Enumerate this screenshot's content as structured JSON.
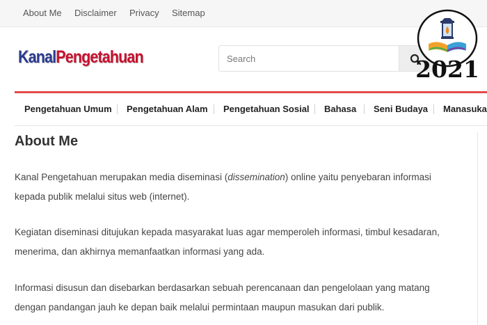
{
  "top_menu": {
    "items": [
      "About Me",
      "Disclaimer",
      "Privacy",
      "Sitemap"
    ]
  },
  "logo": {
    "part1": "Kanal",
    "part2": "Pengetahuan"
  },
  "search": {
    "placeholder": "Search",
    "icon": "search-icon"
  },
  "badge": {
    "year": "2021",
    "icon": "lantern-book-icon"
  },
  "nav": {
    "items": [
      "Pengetahuan Umum",
      "Pengetahuan Alam",
      "Pengetahuan Sosial",
      "Bahasa",
      "Seni Budaya",
      "Manasuka"
    ]
  },
  "colors": {
    "accent": "#e44a4a",
    "logo_blue": "#2b3a8f",
    "logo_red": "#c8102e"
  },
  "content": {
    "title": "About Me",
    "p1": {
      "before": "Kanal Pengetahuan merupakan media diseminasi (",
      "em": "dissemination",
      "after": ") online yaitu penyebaran informasi",
      "line2": "kepada publik melalui situs web (internet)."
    },
    "p2": {
      "line1": "Kegiatan diseminasi ditujukan kepada masyarakat luas agar memperoleh informasi, timbul kesadaran,",
      "line2": "menerima, dan akhirnya memanfaatkan informasi yang ada."
    },
    "p3": {
      "line1": "Informasi disusun dan disebarkan berdasarkan sebuah perencanaan dan pengelolaan yang matang",
      "line2": "dengan pandangan jauh ke depan baik melalui permintaan maupun masukan dari publik."
    }
  }
}
